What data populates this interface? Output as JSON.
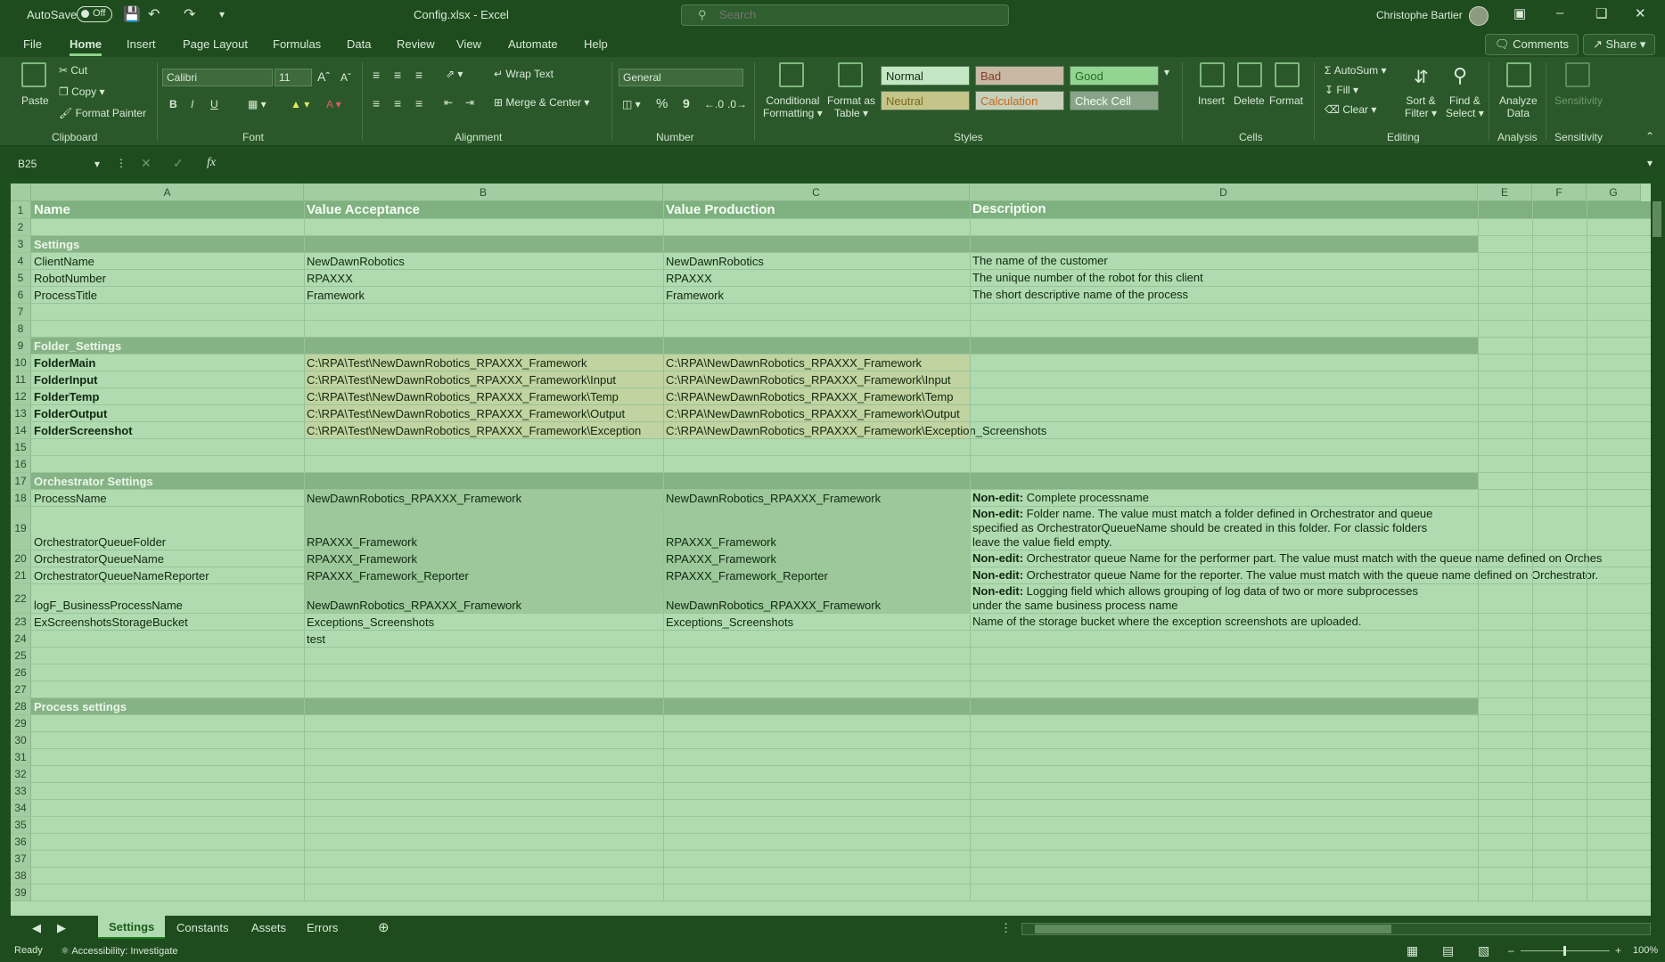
{
  "titlebar": {
    "autosave_label": "AutoSave",
    "autosave_state": "Off",
    "document_title": "Config.xlsx - Excel",
    "search_placeholder": "Search",
    "user_name": "Christophe Bartier"
  },
  "ribbon_tabs": [
    "File",
    "Home",
    "Insert",
    "Page Layout",
    "Formulas",
    "Data",
    "Review",
    "View",
    "Automate",
    "Help"
  ],
  "ribbon_buttons": {
    "comments": "Comments",
    "share": "Share"
  },
  "ribbon": {
    "clipboard": {
      "paste": "Paste",
      "cut": "Cut",
      "copy": "Copy",
      "format_painter": "Format Painter",
      "label": "Clipboard"
    },
    "font": {
      "name": "Calibri",
      "size": "11",
      "bold": "B",
      "italic": "I",
      "underline": "U",
      "label": "Font"
    },
    "alignment": {
      "wrap_text": "Wrap Text",
      "merge_center": "Merge & Center",
      "label": "Alignment"
    },
    "number": {
      "format": "General",
      "percent": "%",
      "comma": "9",
      "label": "Number"
    },
    "styles": {
      "conditional": "Conditional",
      "conditional2": "Formatting",
      "format_table": "Format as",
      "format_table2": "Table",
      "label": "Styles",
      "cells": [
        {
          "name": "Normal",
          "bg": "#c3e6c3",
          "fg": "#1a2a1a"
        },
        {
          "name": "Bad",
          "bg": "#c8b9a4",
          "fg": "#8a3a2a"
        },
        {
          "name": "Good",
          "bg": "#92d592",
          "fg": "#2a6a2a"
        },
        {
          "name": "Neutral",
          "bg": "#c5c58a",
          "fg": "#7a6a1a"
        },
        {
          "name": "Calculation",
          "bg": "#c8cfba",
          "fg": "#c86a1a"
        },
        {
          "name": "Check Cell",
          "bg": "#8aa48a",
          "fg": "#f0fff0"
        }
      ]
    },
    "cells": {
      "insert": "Insert",
      "delete": "Delete",
      "format": "Format",
      "label": "Cells"
    },
    "editing": {
      "autosum": "AutoSum",
      "fill": "Fill",
      "clear": "Clear",
      "sort_filter": "Sort &",
      "sort_filter2": "Filter",
      "find_select": "Find &",
      "find_select2": "Select",
      "label": "Editing"
    },
    "analysis": {
      "analyze": "Analyze",
      "analyze2": "Data",
      "label": "Analysis"
    },
    "sensitivity": {
      "name": "Sensitivity",
      "label": "Sensitivity"
    }
  },
  "formula_bar": {
    "name_box": "B25",
    "fx": "fx",
    "value": ""
  },
  "columns": [
    "A",
    "B",
    "C",
    "D",
    "E",
    "F",
    "G"
  ],
  "rows": [
    {
      "n": "1",
      "a": "Name",
      "b": "Value Acceptance",
      "c": "Value Production",
      "d": "Description"
    },
    {
      "n": "2",
      "a": "",
      "b": "",
      "c": "",
      "d": ""
    },
    {
      "n": "3",
      "a": "Settings",
      "b": "",
      "c": "",
      "d": ""
    },
    {
      "n": "4",
      "a": "ClientName",
      "b": "NewDawnRobotics",
      "c": "NewDawnRobotics",
      "d": "The name of the customer"
    },
    {
      "n": "5",
      "a": "RobotNumber",
      "b": "RPAXXX",
      "c": "RPAXXX",
      "d": "The unique number of the robot for this client"
    },
    {
      "n": "6",
      "a": "ProcessTitle",
      "b": "Framework",
      "c": "Framework",
      "d": "The short descriptive name of the process"
    },
    {
      "n": "7",
      "a": "",
      "b": "",
      "c": "",
      "d": ""
    },
    {
      "n": "8",
      "a": "",
      "b": "",
      "c": "",
      "d": ""
    },
    {
      "n": "9",
      "a": "Folder_Settings",
      "b": "",
      "c": "",
      "d": ""
    },
    {
      "n": "10",
      "a": "FolderMain",
      "b": "C:\\RPA\\Test\\NewDawnRobotics_RPAXXX_Framework",
      "c": "C:\\RPA\\NewDawnRobotics_RPAXXX_Framework",
      "d": ""
    },
    {
      "n": "11",
      "a": "FolderInput",
      "b": "C:\\RPA\\Test\\NewDawnRobotics_RPAXXX_Framework\\Input",
      "c": "C:\\RPA\\NewDawnRobotics_RPAXXX_Framework\\Input",
      "d": ""
    },
    {
      "n": "12",
      "a": "FolderTemp",
      "b": "C:\\RPA\\Test\\NewDawnRobotics_RPAXXX_Framework\\Temp",
      "c": "C:\\RPA\\NewDawnRobotics_RPAXXX_Framework\\Temp",
      "d": ""
    },
    {
      "n": "13",
      "a": "FolderOutput",
      "b": "C:\\RPA\\Test\\NewDawnRobotics_RPAXXX_Framework\\Output",
      "c": "C:\\RPA\\NewDawnRobotics_RPAXXX_Framework\\Output",
      "d": ""
    },
    {
      "n": "14",
      "a": "FolderScreenshot",
      "b": "C:\\RPA\\Test\\NewDawnRobotics_RPAXXX_Framework\\Exception",
      "c": "C:\\RPA\\NewDawnRobotics_RPAXXX_Framework\\Exception_Screenshots",
      "d": ""
    },
    {
      "n": "15",
      "a": "",
      "b": "",
      "c": "",
      "d": ""
    },
    {
      "n": "16",
      "a": "",
      "b": "",
      "c": "",
      "d": ""
    },
    {
      "n": "17",
      "a": "Orchestrator Settings",
      "b": "",
      "c": "",
      "d": ""
    },
    {
      "n": "18",
      "a": "ProcessName",
      "b": "NewDawnRobotics_RPAXXX_Framework",
      "c": "NewDawnRobotics_RPAXXX_Framework",
      "d_bold": "Non-edit:",
      "d": " Complete processname"
    },
    {
      "n": "19",
      "a": "OrchestratorQueueFolder",
      "b": "RPAXXX_Framework",
      "c": "RPAXXX_Framework",
      "d_bold": "Non-edit:",
      "d": " Folder name. The value must match a folder defined in Orchestrator and queue",
      "d2": "specified as OrchestratorQueueName should be created in this folder. For classic folders",
      "d3": "leave the value field empty."
    },
    {
      "n": "20",
      "a": "OrchestratorQueueName",
      "b": "RPAXXX_Framework",
      "c": "RPAXXX_Framework",
      "d_bold": "Non-edit:",
      "d": " Orchestrator queue Name for the performer part. The value must match with the queue name defined on Orches"
    },
    {
      "n": "21",
      "a": "OrchestratorQueueNameReporter",
      "b": "RPAXXX_Framework_Reporter",
      "c": "RPAXXX_Framework_Reporter",
      "d_bold": "Non-edit:",
      "d": " Orchestrator queue Name for the reporter. The value must match with the queue name defined on Orchestrator."
    },
    {
      "n": "22",
      "a": "logF_BusinessProcessName",
      "b": "NewDawnRobotics_RPAXXX_Framework",
      "c": "NewDawnRobotics_RPAXXX_Framework",
      "d_bold": "Non-edit:",
      "d": " Logging field which allows grouping of log data of two or more subprocesses",
      "d2": "under the same business process name"
    },
    {
      "n": "23",
      "a": "ExScreenshotsStorageBucket",
      "b": "Exceptions_Screenshots",
      "c": "Exceptions_Screenshots",
      "d": "Name of the storage bucket where the exception screenshots are uploaded."
    },
    {
      "n": "24",
      "a": "",
      "b": "test",
      "c": "",
      "d": ""
    },
    {
      "n": "25",
      "a": "",
      "b": "",
      "c": "",
      "d": ""
    },
    {
      "n": "26",
      "a": "",
      "b": "",
      "c": "",
      "d": ""
    },
    {
      "n": "27",
      "a": "",
      "b": "",
      "c": "",
      "d": ""
    },
    {
      "n": "28",
      "a": "Process settings",
      "b": "",
      "c": "",
      "d": ""
    },
    {
      "n": "29",
      "a": "",
      "b": "",
      "c": "",
      "d": ""
    },
    {
      "n": "30",
      "a": "",
      "b": "",
      "c": "",
      "d": ""
    },
    {
      "n": "31",
      "a": "",
      "b": "",
      "c": "",
      "d": ""
    },
    {
      "n": "32",
      "a": "",
      "b": "",
      "c": "",
      "d": ""
    },
    {
      "n": "33",
      "a": "",
      "b": "",
      "c": "",
      "d": ""
    },
    {
      "n": "34",
      "a": "",
      "b": "",
      "c": "",
      "d": ""
    },
    {
      "n": "35",
      "a": "",
      "b": "",
      "c": "",
      "d": ""
    },
    {
      "n": "36",
      "a": "",
      "b": "",
      "c": "",
      "d": ""
    },
    {
      "n": "37",
      "a": "",
      "b": "",
      "c": "",
      "d": ""
    },
    {
      "n": "38",
      "a": "",
      "b": "",
      "c": "",
      "d": ""
    },
    {
      "n": "39",
      "a": "",
      "b": "",
      "c": "",
      "d": ""
    }
  ],
  "sheet_tabs": [
    "Settings",
    "Constants",
    "Assets",
    "Errors"
  ],
  "status": {
    "ready": "Ready",
    "accessibility": "Accessibility: Investigate",
    "zoom": "100%"
  },
  "colors": {
    "header_row": "#7fb07f",
    "section_row": "#86b386",
    "grid_bg": "#b0dbb0",
    "highlight": "#c0d3a0",
    "orchestrator_fill": "#9cc89c"
  }
}
